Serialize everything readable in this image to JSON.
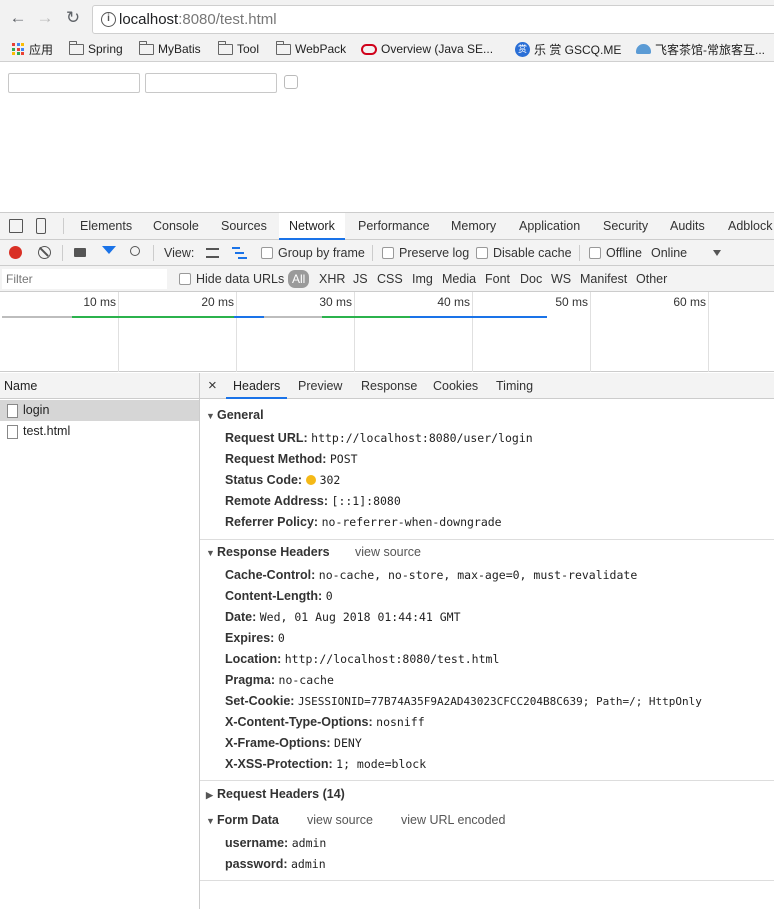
{
  "browser": {
    "url_host": "localhost",
    "url_rest": ":8080/test.html",
    "bookmarks": [
      {
        "label": "应用",
        "icon": "apps-grid-icon"
      },
      {
        "label": "Spring",
        "icon": "folder-icon"
      },
      {
        "label": "MyBatis",
        "icon": "folder-icon"
      },
      {
        "label": "Tool",
        "icon": "folder-icon"
      },
      {
        "label": "WebPack",
        "icon": "folder-icon"
      },
      {
        "label": "Overview (Java SE...",
        "icon": "oracle-icon"
      },
      {
        "label": "乐 赏 GSCQ.ME",
        "icon": "reward-icon"
      },
      {
        "label": "飞客茶馆-常旅客互...",
        "icon": "feike-icon"
      }
    ]
  },
  "devtools": {
    "tabs": [
      "Elements",
      "Console",
      "Sources",
      "Network",
      "Performance",
      "Memory",
      "Application",
      "Security",
      "Audits",
      "Adblock"
    ],
    "active_tab": "Network",
    "toolbar": {
      "view_label": "View:",
      "group_by_frame": "Group by frame",
      "preserve_log": "Preserve log",
      "disable_cache": "Disable cache",
      "offline": "Offline",
      "throttle": "Online"
    },
    "filter": {
      "placeholder": "Filter",
      "hide_data_urls": "Hide data URLs",
      "types": [
        "All",
        "XHR",
        "JS",
        "CSS",
        "Img",
        "Media",
        "Font",
        "Doc",
        "WS",
        "Manifest",
        "Other"
      ]
    },
    "overview_ticks": [
      "10 ms",
      "20 ms",
      "30 ms",
      "40 ms",
      "50 ms",
      "60 ms"
    ],
    "requests_header": "Name",
    "requests": [
      "login",
      "test.html"
    ],
    "detail_tabs": [
      "Headers",
      "Preview",
      "Response",
      "Cookies",
      "Timing"
    ],
    "close_glyph": "×",
    "general": {
      "title": "General",
      "request_url": {
        "k": "Request URL:",
        "v": "http://localhost:8080/user/login"
      },
      "request_method": {
        "k": "Request Method:",
        "v": "POST"
      },
      "status_code": {
        "k": "Status Code:",
        "v": "302"
      },
      "remote_address": {
        "k": "Remote Address:",
        "v": "[::1]:8080"
      },
      "referrer_policy": {
        "k": "Referrer Policy:",
        "v": "no-referrer-when-downgrade"
      }
    },
    "response_headers": {
      "title": "Response Headers",
      "view_source": "view source",
      "items": [
        {
          "k": "Cache-Control:",
          "v": "no-cache, no-store, max-age=0, must-revalidate"
        },
        {
          "k": "Content-Length:",
          "v": "0"
        },
        {
          "k": "Date:",
          "v": "Wed, 01 Aug 2018 01:44:41 GMT"
        },
        {
          "k": "Expires:",
          "v": "0"
        },
        {
          "k": "Location:",
          "v": "http://localhost:8080/test.html"
        },
        {
          "k": "Pragma:",
          "v": "no-cache"
        },
        {
          "k": "Set-Cookie:",
          "v": "JSESSIONID=77B74A35F9A2AD43023CFCC204B8C639; Path=/; HttpOnly"
        },
        {
          "k": "X-Content-Type-Options:",
          "v": "nosniff"
        },
        {
          "k": "X-Frame-Options:",
          "v": "DENY"
        },
        {
          "k": "X-XSS-Protection:",
          "v": "1; mode=block"
        }
      ]
    },
    "request_headers": {
      "title": "Request Headers (14)"
    },
    "form_data": {
      "title": "Form Data",
      "view_source": "view source",
      "view_url_encoded": "view URL encoded",
      "items": [
        {
          "k": "username:",
          "v": "admin"
        },
        {
          "k": "password:",
          "v": "admin"
        }
      ]
    },
    "colors": {
      "accent": "#1a73e8",
      "record": "#d93025",
      "status_dot": "#f5b917"
    }
  }
}
